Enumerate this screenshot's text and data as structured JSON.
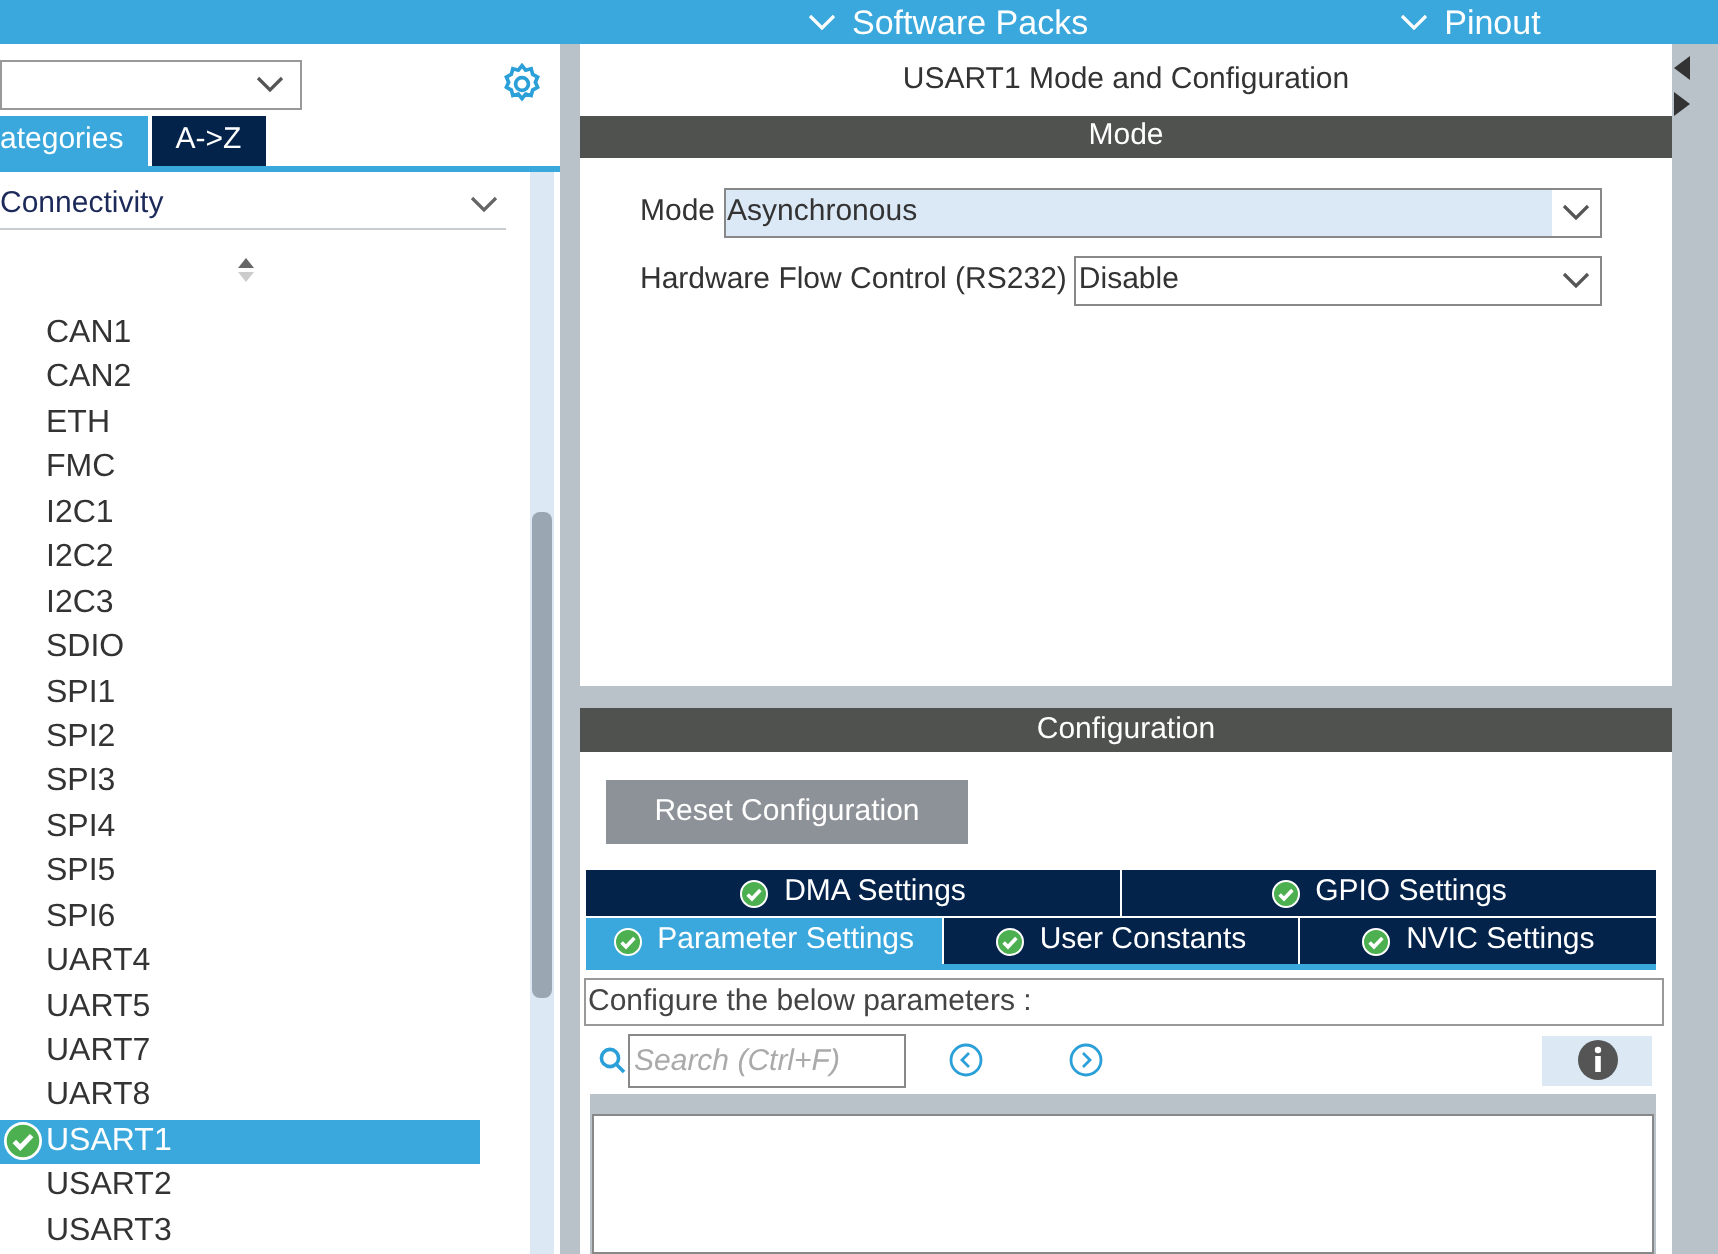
{
  "top_bar": {
    "menus": [
      {
        "label": "Software Packs"
      },
      {
        "label": "Pinout"
      }
    ]
  },
  "left_panel": {
    "tabs": [
      {
        "label": "ategories",
        "selected": true
      },
      {
        "label": "A->Z",
        "selected": false
      }
    ],
    "category": {
      "label": "Connectivity",
      "expanded": true
    },
    "items": [
      {
        "label": "CAN1",
        "selected": false,
        "configured": false
      },
      {
        "label": "CAN2",
        "selected": false,
        "configured": false
      },
      {
        "label": "ETH",
        "selected": false,
        "configured": false
      },
      {
        "label": "FMC",
        "selected": false,
        "configured": false
      },
      {
        "label": "I2C1",
        "selected": false,
        "configured": false
      },
      {
        "label": "I2C2",
        "selected": false,
        "configured": false
      },
      {
        "label": "I2C3",
        "selected": false,
        "configured": false
      },
      {
        "label": "SDIO",
        "selected": false,
        "configured": false
      },
      {
        "label": "SPI1",
        "selected": false,
        "configured": false
      },
      {
        "label": "SPI2",
        "selected": false,
        "configured": false
      },
      {
        "label": "SPI3",
        "selected": false,
        "configured": false
      },
      {
        "label": "SPI4",
        "selected": false,
        "configured": false
      },
      {
        "label": "SPI5",
        "selected": false,
        "configured": false
      },
      {
        "label": "SPI6",
        "selected": false,
        "configured": false
      },
      {
        "label": "UART4",
        "selected": false,
        "configured": false
      },
      {
        "label": "UART5",
        "selected": false,
        "configured": false
      },
      {
        "label": "UART7",
        "selected": false,
        "configured": false
      },
      {
        "label": "UART8",
        "selected": false,
        "configured": false
      },
      {
        "label": "USART1",
        "selected": true,
        "configured": true
      },
      {
        "label": "USART2",
        "selected": false,
        "configured": false
      },
      {
        "label": "USART3",
        "selected": false,
        "configured": false
      }
    ]
  },
  "right_panel": {
    "title": "USART1 Mode and Configuration",
    "mode_section": {
      "header": "Mode",
      "fields": [
        {
          "label": "Mode",
          "value": "Asynchronous",
          "focused": true
        },
        {
          "label": "Hardware Flow Control (RS232)",
          "value": "Disable",
          "focused": false
        }
      ]
    },
    "configuration_section": {
      "header": "Configuration",
      "reset_button": "Reset Configuration",
      "tab_rows": [
        [
          {
            "label": "DMA Settings",
            "selected": false,
            "checked": true
          },
          {
            "label": "GPIO Settings",
            "selected": false,
            "checked": true
          }
        ],
        [
          {
            "label": "Parameter Settings",
            "selected": true,
            "checked": true
          },
          {
            "label": "User Constants",
            "selected": false,
            "checked": true
          },
          {
            "label": "NVIC Settings",
            "selected": false,
            "checked": true
          }
        ]
      ],
      "description": "Configure the below parameters :",
      "search": {
        "placeholder": "Search (Ctrl+F)"
      }
    }
  }
}
